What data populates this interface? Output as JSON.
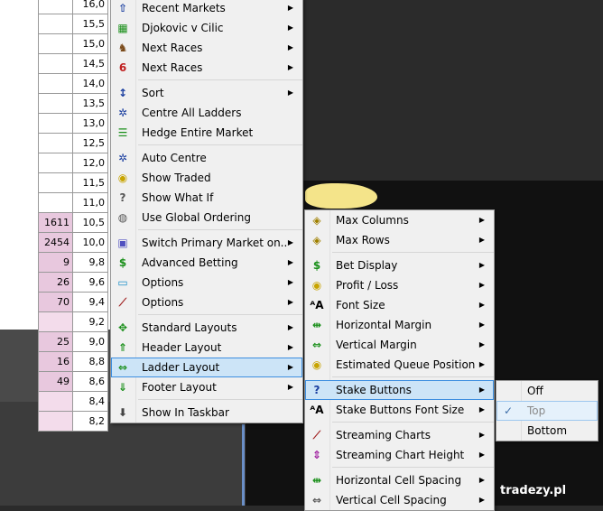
{
  "ladder": [
    {
      "vol": "",
      "price": "16,0"
    },
    {
      "vol": "",
      "price": "15,5"
    },
    {
      "vol": "",
      "price": "15,0"
    },
    {
      "vol": "",
      "price": "14,5"
    },
    {
      "vol": "",
      "price": "14,0"
    },
    {
      "vol": "",
      "price": "13,5"
    },
    {
      "vol": "",
      "price": "13,0"
    },
    {
      "vol": "",
      "price": "12,5"
    },
    {
      "vol": "",
      "price": "12,0"
    },
    {
      "vol": "",
      "price": "11,5"
    },
    {
      "vol": "",
      "price": "11,0"
    },
    {
      "vol": "1611",
      "price": "10,5"
    },
    {
      "vol": "2454",
      "price": "10,0"
    },
    {
      "vol": "9",
      "price": "9,8"
    },
    {
      "vol": "26",
      "price": "9,6"
    },
    {
      "vol": "70",
      "price": "9,4"
    },
    {
      "vol": "",
      "price": "9,2"
    },
    {
      "vol": "25",
      "price": "9,0"
    },
    {
      "vol": "16",
      "price": "8,8"
    },
    {
      "vol": "49",
      "price": "8,6"
    },
    {
      "vol": "",
      "price": "8,4"
    },
    {
      "vol": "",
      "price": "8,2"
    }
  ],
  "menu1": [
    {
      "label": "Recent Markets",
      "icon": "arrow-up-icon",
      "arrow": true
    },
    {
      "label": "Djokovic v Cilic",
      "icon": "tennis-icon",
      "arrow": true
    },
    {
      "label": "Next Races",
      "icon": "horse-icon",
      "arrow": true
    },
    {
      "label": "Next Races",
      "icon": "greyhound-icon",
      "arrow": true,
      "sep_after": true
    },
    {
      "label": "Sort",
      "icon": "sort-icon",
      "arrow": true
    },
    {
      "label": "Centre All Ladders",
      "icon": "centre-icon",
      "arrow": false
    },
    {
      "label": "Hedge Entire Market",
      "icon": "hedge-icon",
      "arrow": false,
      "sep_after": true
    },
    {
      "label": "Auto Centre",
      "icon": "auto-centre-icon",
      "arrow": false
    },
    {
      "label": "Show Traded",
      "icon": "coins-icon",
      "arrow": false
    },
    {
      "label": "Show What If",
      "icon": "question-icon",
      "arrow": false
    },
    {
      "label": "Use Global Ordering",
      "icon": "globe-icon",
      "arrow": false,
      "sep_after": true
    },
    {
      "label": "Switch Primary Market on..",
      "icon": "switch-icon",
      "arrow": true
    },
    {
      "label": "Advanced Betting",
      "icon": "dollar-icon",
      "arrow": true
    },
    {
      "label": "Options",
      "icon": "monitor-icon",
      "arrow": true
    },
    {
      "label": "Options",
      "icon": "chart-icon",
      "arrow": true,
      "sep_after": true
    },
    {
      "label": "Standard Layouts",
      "icon": "move-icon",
      "arrow": true
    },
    {
      "label": "Header Layout",
      "icon": "header-icon",
      "arrow": true
    },
    {
      "label": "Ladder Layout",
      "icon": "ladder-icon",
      "arrow": true,
      "selected": true
    },
    {
      "label": "Footer Layout",
      "icon": "footer-icon",
      "arrow": true,
      "sep_after": true
    },
    {
      "label": "Show In Taskbar",
      "icon": "download-icon",
      "arrow": false
    }
  ],
  "menu2": [
    {
      "label": "Max Columns",
      "icon": "diamond-icon",
      "arrow": true
    },
    {
      "label": "Max Rows",
      "icon": "diamond-icon",
      "arrow": true,
      "sep_after": true
    },
    {
      "label": "Bet Display",
      "icon": "dollar-icon",
      "arrow": true
    },
    {
      "label": "Profit / Loss",
      "icon": "coins-icon",
      "arrow": true
    },
    {
      "label": "Font Size",
      "icon": "font-size-icon",
      "arrow": true
    },
    {
      "label": "Horizontal Margin",
      "icon": "h-margin-icon",
      "arrow": true
    },
    {
      "label": "Vertical Margin",
      "icon": "v-margin-icon",
      "arrow": true
    },
    {
      "label": "Estimated Queue Position",
      "icon": "coins-icon",
      "arrow": true,
      "sep_after": true
    },
    {
      "label": "Stake Buttons",
      "icon": "stake-icon",
      "arrow": true,
      "selected": true
    },
    {
      "label": "Stake Buttons Font Size",
      "icon": "font-size-icon",
      "arrow": true,
      "sep_after": true
    },
    {
      "label": "Streaming Charts",
      "icon": "chart-icon",
      "arrow": true
    },
    {
      "label": "Streaming Chart Height",
      "icon": "height-icon",
      "arrow": true,
      "sep_after": true
    },
    {
      "label": "Horizontal Cell Spacing",
      "icon": "h-spacing-icon",
      "arrow": true
    },
    {
      "label": "Vertical Cell Spacing",
      "icon": "v-spacing-icon",
      "arrow": true
    }
  ],
  "menu3": [
    {
      "label": "Off",
      "checked": false,
      "disabled": false
    },
    {
      "label": "Top",
      "checked": true,
      "disabled": true
    },
    {
      "label": "Bottom",
      "checked": false,
      "disabled": false
    }
  ],
  "watermark": "tradezy.pl",
  "colors": {
    "menu_bg": "#f0f0f0",
    "selected_bg": "#cce4f7",
    "selected_border": "#3d8ee0",
    "pink": "#e8c8de"
  }
}
